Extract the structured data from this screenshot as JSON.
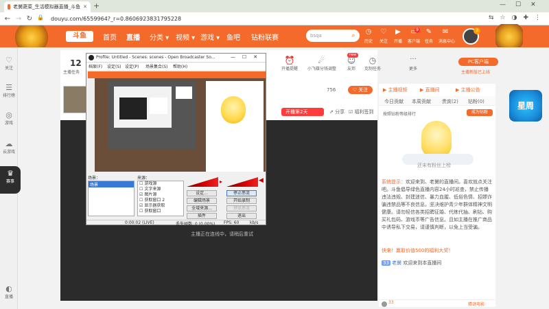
{
  "browser": {
    "tab_title": "老舅蔬菜_生活模拟器直播_斗鱼",
    "new_tab": "+",
    "url": "douyu.com/6559964?_r=0.8606923831795228",
    "window_controls": [
      "—",
      "☐",
      "✕"
    ]
  },
  "site_nav": {
    "home": "首页",
    "live": "直播",
    "category": "分类 ▾",
    "video": "视频 ▾",
    "game": "游戏 ▾",
    "yuba": "鱼吧",
    "esports": "钻粉联赛",
    "search_placeholder": "bsqa",
    "icons": [
      {
        "name": "history",
        "label": "历史",
        "glyph": "◷"
      },
      {
        "name": "follow",
        "label": "关注",
        "glyph": "♡"
      },
      {
        "name": "broadcast",
        "label": "开播",
        "glyph": "▶"
      },
      {
        "name": "client",
        "label": "客户端",
        "glyph": "▭"
      },
      {
        "name": "task",
        "label": "任务",
        "glyph": "✎"
      },
      {
        "name": "message",
        "label": "消息中心",
        "glyph": "✉"
      }
    ],
    "client_badge": "9"
  },
  "sidebar": {
    "items": [
      {
        "label": "关注",
        "glyph": "♡"
      },
      {
        "label": "排行榜",
        "glyph": "☰"
      },
      {
        "label": "游戏",
        "glyph": "◎"
      },
      {
        "label": "云游戏",
        "glyph": "☁"
      },
      {
        "label": "赛事",
        "glyph": "♛"
      },
      {
        "label": "直播",
        "glyph": "◐"
      }
    ]
  },
  "room": {
    "task_count": "12",
    "task_label": "主播任务",
    "tools": [
      {
        "label": "开播提醒",
        "glyph": "⏰"
      },
      {
        "label": "小飞碟分钱调整",
        "glyph": "☄"
      },
      {
        "label": "友邦",
        "glyph": "☺"
      },
      {
        "label": "克制任务",
        "glyph": "◷"
      },
      {
        "label": "更多",
        "glyph": "···"
      }
    ],
    "pc_client_button": "PC客户端",
    "pc_client_sub": "主播新版已上线",
    "fans": "756",
    "follow_button": "关注",
    "share": "分享",
    "report": "福利签到",
    "gift_banner": "开播第2天",
    "gift_count": "2"
  },
  "video": {
    "status_text": "主播正在连线中，请稍后重试"
  },
  "obs": {
    "title": "Profile: Untitled - Scenes: scenes - Open Broadcaster So...",
    "menu": [
      "档案(F)",
      "设定(S)",
      "设定(P)",
      "场景集合(S)",
      "帮助(H)"
    ],
    "scenes_label": "场景：",
    "scene_item": "场景",
    "sources_label": "来源：",
    "sources": [
      {
        "name": "游戏源",
        "checked": false
      },
      {
        "name": "文字来源",
        "checked": false
      },
      {
        "name": "图片源",
        "checked": true
      },
      {
        "name": "获取窗口 2",
        "checked": false
      },
      {
        "name": "显示器获取",
        "checked": true
      },
      {
        "name": "获取窗口",
        "checked": false
      }
    ],
    "buttons": [
      [
        "设定...",
        "停止串流"
      ],
      [
        "编辑场景",
        "开始录制"
      ],
      [
        "全域来源...",
        "预览串流"
      ],
      [
        "插件",
        "退出"
      ]
    ],
    "status_time": "0:00:02 (LIVE)",
    "status_dropped": "丢失帧数: 0 (0.00%)",
    "status_fps": "FPS: 60",
    "status_kbps": "kb/s"
  },
  "right_panel": {
    "tabs": [
      "主播视频",
      "直播间",
      "主播公告"
    ],
    "subtabs": [
      "今日贡献",
      "本周贡献",
      "贵宾(2)",
      "钻粉(0)"
    ],
    "rank_label": "按照钻粉等级排行",
    "rank_button": "成为钻粉",
    "empty_text": "还未有粉丝上榜",
    "system_label": "系统提示：",
    "system_message": "欢迎来到、老舅的直播间。喜欢就点关注吧。斗鱼倡导绿色直播内容24小时巡查，禁止传播违法违规、封建迷信、暴力血腥、低俗色情、招嫖诈骗违禁品等不良信息。坚决维护青少年群体精神文明健康。请勿轻信各类招聘征婚、代练代抽、刷钻、购买礼包码、游戏币等广告信息。且如主播在推广商品中诱导私下交易，请谨慎判断，以免上当受骗。",
    "promo": "快来！赢取价值500的福利大奖！",
    "welcome_user": "老舅",
    "welcome_text": "欢迎来到本直播间",
    "footer_badge": "33",
    "footer_link": "猜谜电影"
  },
  "floats": {
    "top_badge": "3",
    "weekstar": "星周"
  },
  "colors": {
    "accent": "#f46a2a",
    "header": "#f46a2a",
    "video_bg": "#2b2b2b"
  }
}
